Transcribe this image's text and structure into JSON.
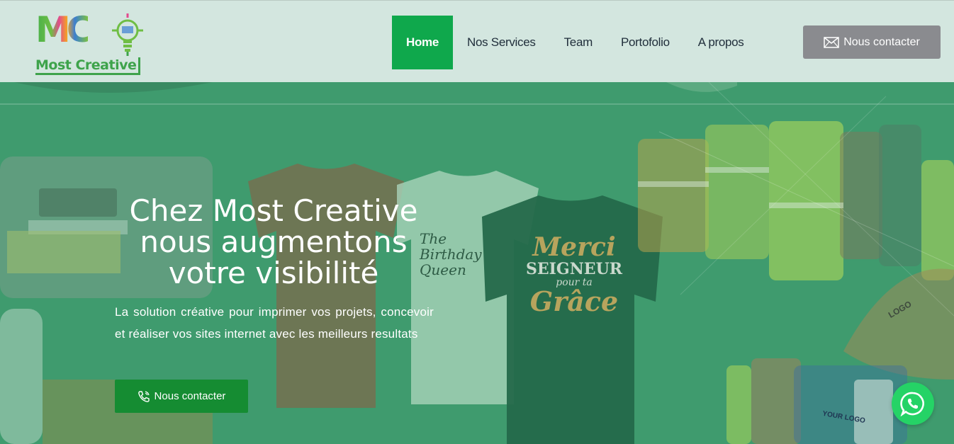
{
  "brand": {
    "logo_letters": "MC",
    "logo_name": "Most Creative"
  },
  "nav": {
    "items": [
      {
        "label": "Home",
        "active": true
      },
      {
        "label": "Nos Services",
        "active": false
      },
      {
        "label": "Team",
        "active": false
      },
      {
        "label": "Portofolio",
        "active": false
      },
      {
        "label": "A propos",
        "active": false
      }
    ],
    "contact_label": "Nous contacter",
    "contact_icon": "envelope-icon"
  },
  "hero": {
    "title_line1": "Chez Most Creative",
    "title_line2": "nous augmentons",
    "title_line3": "votre visibilité",
    "description": "La solution créative pour imprimer vos projets, concevoir et réaliser vos sites internet avec les meilleurs resultats",
    "button_label": "Nous contacter",
    "button_icon": "phone-icon",
    "shirt_text_1": "Merci",
    "shirt_text_2": "SEIGNEUR",
    "shirt_text_3": "pour ta",
    "shirt_text_4": "Grâce",
    "birthday_text_1": "The",
    "birthday_text_2": "Birthday",
    "birthday_text_3": "Queen",
    "mockup_logo": "LOGO",
    "mockup_your_logo": "YOUR LOGO"
  },
  "colors": {
    "header_bg": "#d3e6df",
    "nav_active": "#0fa84c",
    "contact_top_bg": "#8a8b8f",
    "hero_overlay": "#3f9b6e",
    "hero_button": "#158c32",
    "whatsapp": "#25d366"
  },
  "floating": {
    "whatsapp_icon": "whatsapp-icon"
  }
}
